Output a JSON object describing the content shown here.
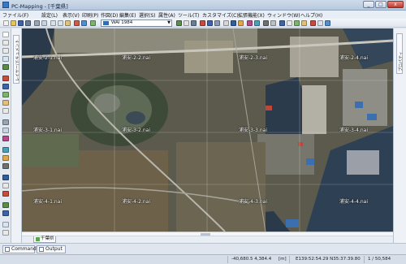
{
  "window": {
    "title": "PC-Mapping - [千葉県]",
    "min_label": "_",
    "max_label": "□",
    "close_label": "x"
  },
  "menu": [
    "ファイル(F)",
    "設定(L)",
    "表示(V)",
    "印刷(P)",
    "作図(D)",
    "編集(E)",
    "選択(S)",
    "属性(A)",
    "ツール(T)",
    "カスタマイズ(C)",
    "拡張機能(X)",
    "ウィンドウ(W)",
    "ヘルプ(H)"
  ],
  "toolbar": {
    "coordinate_system": "WAI 1984",
    "dropdown_icon": "chevron-down-icon"
  },
  "left_panel": {
    "tab_label": "レイヤー/ドキュメント"
  },
  "right_panel": {
    "tab_label": "プロパティ"
  },
  "map": {
    "tiles": [
      {
        "label": "浦安-2-1.nai"
      },
      {
        "label": "浦安-2-2.nai"
      },
      {
        "label": "浦安-2-3.nai"
      },
      {
        "label": "浦安-2-4.nai"
      },
      {
        "label": "浦安-3-1.nai"
      },
      {
        "label": "浦安-3-2.nai"
      },
      {
        "label": "浦安-3-3.nai"
      },
      {
        "label": "浦安-3-4.nai"
      },
      {
        "label": "浦安-4-1.nai"
      },
      {
        "label": "浦安-4-2.nai"
      },
      {
        "label": "浦安-4-3.nai"
      },
      {
        "label": "浦安-4-4.nai"
      }
    ],
    "tab_label": "千葉県"
  },
  "bottom_tabs": [
    {
      "label": "Command"
    },
    {
      "label": "Output"
    }
  ],
  "status": {
    "xy": "-40,680.5  4,384.4",
    "unit": "[m]",
    "latlon": "E139:52:54.29 N35:37:39.80",
    "page": "1 / 50,584"
  },
  "colors": {
    "water": "#2b3a4a",
    "land": "#5b5a4c",
    "accent": "#3b78c4"
  }
}
